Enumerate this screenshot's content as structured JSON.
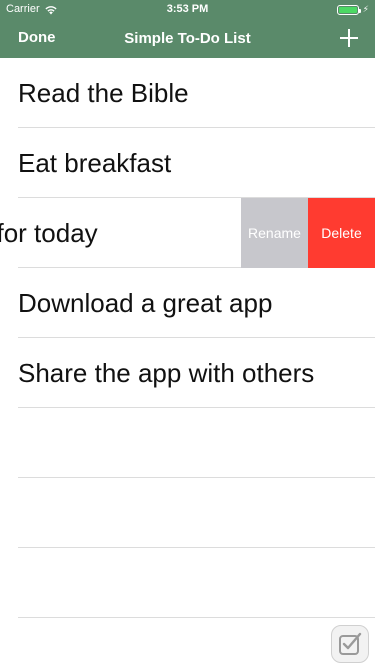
{
  "status_bar": {
    "carrier": "Carrier",
    "time": "3:53 PM",
    "wifi_icon": "wifi-icon",
    "battery_icon": "battery-icon",
    "battery_level": 1.0
  },
  "nav": {
    "done_label": "Done",
    "title": "Simple To-Do List",
    "add_icon": "plus-icon"
  },
  "list": {
    "items": [
      {
        "label": "Read the Bible"
      },
      {
        "label": "Eat breakfast"
      },
      {
        "label": "Make a list for today",
        "swiped": true
      },
      {
        "label": "Download a great app"
      },
      {
        "label": "Share the app with others"
      }
    ],
    "empty_rows": 3
  },
  "row_actions": {
    "rename_label": "Rename",
    "delete_label": "Delete",
    "rename_color": "#c7c7cc",
    "delete_color": "#ff3b30"
  },
  "theme": {
    "bar_color": "#5a8a6a"
  },
  "badge_icon": "app-badge-icon"
}
